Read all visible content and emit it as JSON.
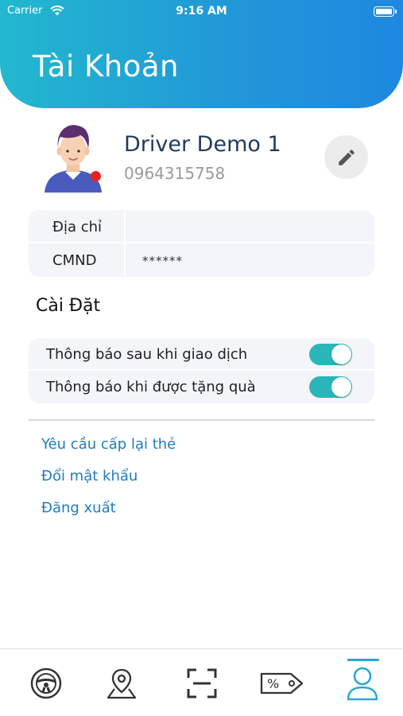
{
  "status_bar": {
    "carrier": "Carrier",
    "time": "9:16 AM"
  },
  "header": {
    "title": "Tài Khoản",
    "gradient_start": "#22b8cf",
    "gradient_end": "#1e88e0"
  },
  "profile": {
    "name": "Driver Demo 1",
    "phone": "0964315758",
    "avatar_icon": "avatar-icon",
    "edit_icon": "pencil-icon"
  },
  "info": [
    {
      "label": "Địa chỉ",
      "value": ""
    },
    {
      "label": "CMND",
      "value": "******"
    }
  ],
  "settings": {
    "title": "Cài Đặt",
    "items": [
      {
        "label": "Thông báo sau khi giao dịch",
        "enabled": true
      },
      {
        "label": "Thông báo khi được tặng quà",
        "enabled": true
      }
    ],
    "toggle_color": "#2bb5b8"
  },
  "links": [
    {
      "label": "Yêu cầu cấp lại thẻ"
    },
    {
      "label": "Đổi mật khẩu"
    },
    {
      "label": "Đăng xuất"
    }
  ],
  "link_color": "#1f7cc0",
  "tabbar": {
    "tabs": [
      {
        "icon": "steering-wheel-icon"
      },
      {
        "icon": "map-pin-icon"
      },
      {
        "icon": "scan-icon"
      },
      {
        "icon": "discount-tag-icon"
      },
      {
        "icon": "user-icon",
        "active": true
      }
    ],
    "active_color": "#2aa7d4"
  }
}
